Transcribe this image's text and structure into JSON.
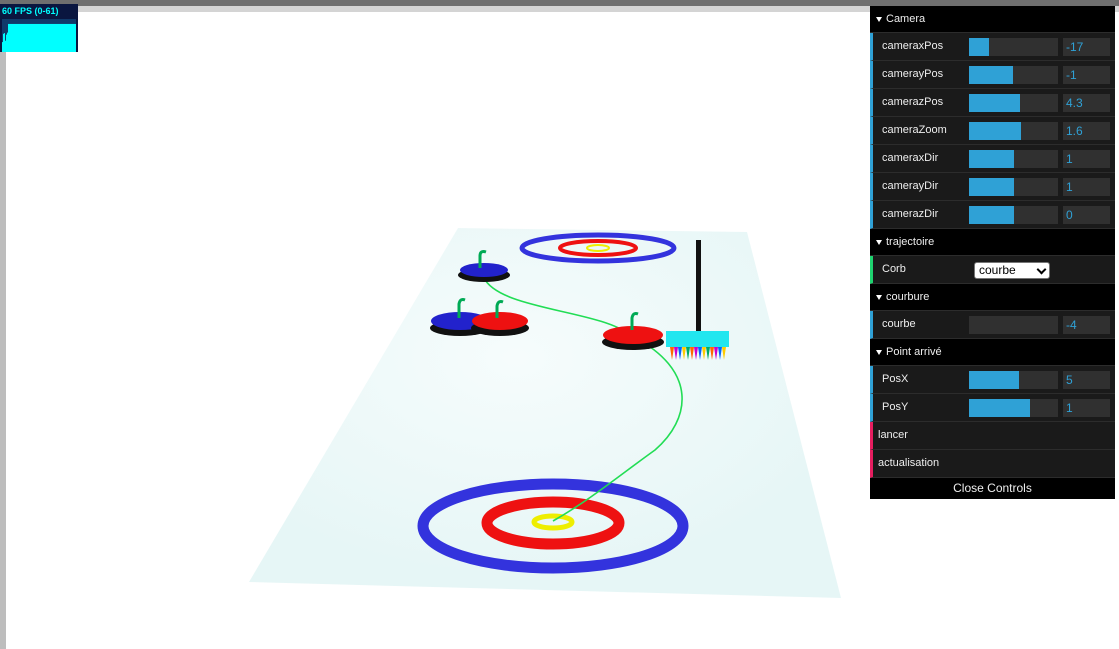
{
  "stats": {
    "fps_label": "60 FPS (0-61)",
    "fps_level": 0.85
  },
  "scene": {
    "ice_color": "#e9f8f8",
    "ring_colors": {
      "outer": "#3333dd",
      "middle": "#ee1111",
      "center": "#eeee00"
    },
    "trajectory_color": "#22dd55",
    "broom_color": "#22e6ef",
    "stone_colors": [
      "#2222cc",
      "#ee1111",
      "#2222cc",
      "#ee1111"
    ]
  },
  "gui": {
    "accent": "#2fa1d6",
    "camera": {
      "title": "Camera",
      "rows": [
        {
          "label": "cameraxPos",
          "value": "-17",
          "fill": 0.23
        },
        {
          "label": "camerayPos",
          "value": "-1",
          "fill": 0.49
        },
        {
          "label": "camerazPos",
          "value": "4.3",
          "fill": 0.57
        },
        {
          "label": "cameraZoom",
          "value": "1.6",
          "fill": 0.58
        },
        {
          "label": "cameraxDir",
          "value": "1",
          "fill": 0.51
        },
        {
          "label": "camerayDir",
          "value": "1",
          "fill": 0.51
        },
        {
          "label": "camerazDir",
          "value": "0",
          "fill": 0.5
        }
      ]
    },
    "trajectoire": {
      "title": "trajectoire",
      "corb_label": "Corb",
      "corb_value": "courbe"
    },
    "courbure": {
      "title": "courbure",
      "row": {
        "label": "courbe",
        "value": "-4",
        "fill": 0.0
      }
    },
    "point_arrive": {
      "title": "Point arrivé",
      "rows": [
        {
          "label": "PosX",
          "value": "5",
          "fill": 0.56
        },
        {
          "label": "PosY",
          "value": "1",
          "fill": 0.68
        }
      ]
    },
    "lancer_label": "lancer",
    "actualisation_label": "actualisation",
    "close_label": "Close Controls"
  }
}
